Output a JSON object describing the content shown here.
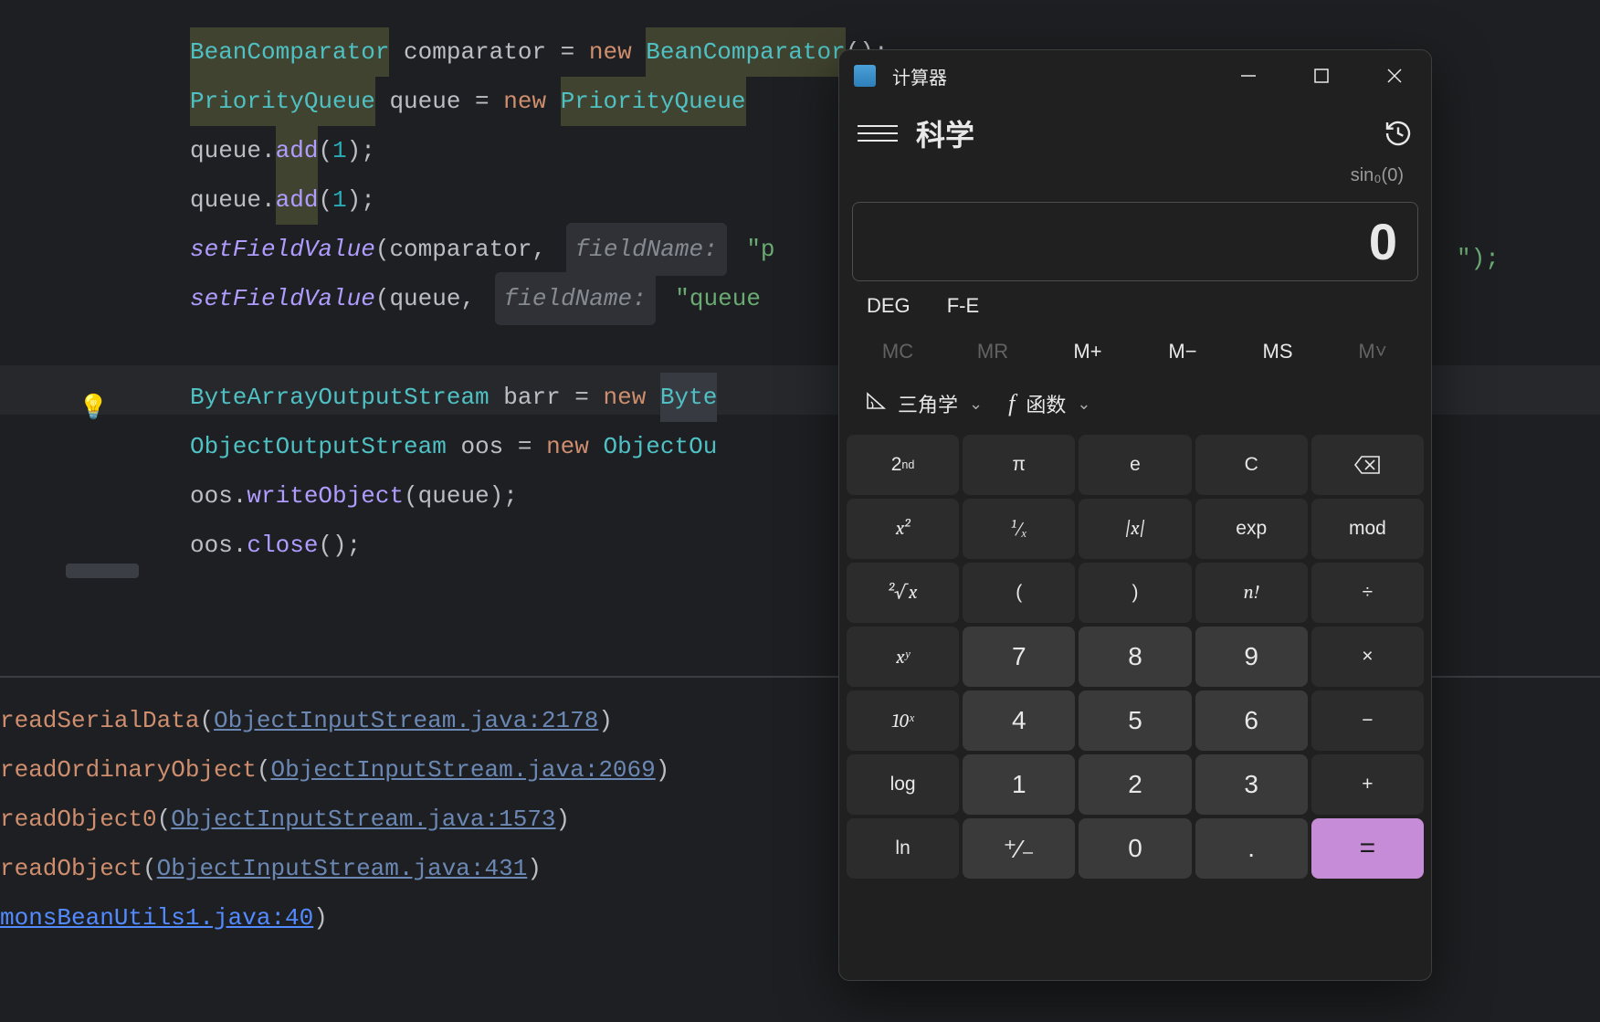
{
  "editor": {
    "lines": [
      {
        "segments": [
          {
            "t": "BeanComparator",
            "c": "tok-type sel"
          },
          {
            "t": " comparator = ",
            "c": "tok-plain"
          },
          {
            "t": "new ",
            "c": "tok-keyword"
          },
          {
            "t": "BeanComparator",
            "c": "tok-type sel"
          },
          {
            "t": "();",
            "c": "tok-plain"
          }
        ]
      },
      {
        "segments": [
          {
            "t": "PriorityQueue",
            "c": "tok-type sel"
          },
          {
            "t": " queue = ",
            "c": "tok-plain"
          },
          {
            "t": "new ",
            "c": "tok-keyword"
          },
          {
            "t": "PriorityQueue",
            "c": "tok-type sel"
          }
        ]
      },
      {
        "segments": [
          {
            "t": "queue.",
            "c": "tok-plain"
          },
          {
            "t": "add",
            "c": "tok-call sel"
          },
          {
            "t": "(",
            "c": "tok-plain"
          },
          {
            "t": "1",
            "c": "tok-num"
          },
          {
            "t": ");",
            "c": "tok-plain"
          }
        ]
      },
      {
        "segments": [
          {
            "t": "queue.",
            "c": "tok-plain"
          },
          {
            "t": "add",
            "c": "tok-call sel"
          },
          {
            "t": "(",
            "c": "tok-plain"
          },
          {
            "t": "1",
            "c": "tok-num"
          },
          {
            "t": ");",
            "c": "tok-plain"
          }
        ]
      },
      {
        "segments": [
          {
            "t": "setFieldValue",
            "c": "tok-method"
          },
          {
            "t": "(comparator, ",
            "c": "tok-plain"
          },
          {
            "t": "fieldName:",
            "c": "tok-hint"
          },
          {
            "t": " \"p",
            "c": "tok-str"
          }
        ]
      },
      {
        "segments": [
          {
            "t": "setFieldValue",
            "c": "tok-method"
          },
          {
            "t": "(queue, ",
            "c": "tok-plain"
          },
          {
            "t": "fieldName:",
            "c": "tok-hint"
          },
          {
            "t": " \"queue",
            "c": "tok-str"
          }
        ]
      },
      {
        "segments": []
      },
      {
        "segments": [
          {
            "t": "ByteArrayOutputStream",
            "c": "tok-type"
          },
          {
            "t": " barr = ",
            "c": "tok-plain"
          },
          {
            "t": "new ",
            "c": "tok-keyword"
          },
          {
            "t": "Byte",
            "c": "tok-type hl"
          }
        ]
      },
      {
        "segments": [
          {
            "t": "ObjectOutputStream",
            "c": "tok-type"
          },
          {
            "t": " oos = ",
            "c": "tok-plain"
          },
          {
            "t": "new ",
            "c": "tok-keyword"
          },
          {
            "t": "ObjectOu",
            "c": "tok-type"
          }
        ]
      },
      {
        "segments": [
          {
            "t": "oos.",
            "c": "tok-plain"
          },
          {
            "t": "writeObject",
            "c": "tok-call"
          },
          {
            "t": "(queue);",
            "c": "tok-plain"
          }
        ]
      },
      {
        "segments": [
          {
            "t": "oos.",
            "c": "tok-plain"
          },
          {
            "t": "close",
            "c": "tok-call"
          },
          {
            "t": "();",
            "c": "tok-plain"
          }
        ]
      }
    ]
  },
  "trace": [
    {
      "method": "readSerialData",
      "link": "ObjectInputStream.java:2178"
    },
    {
      "method": "readOrdinaryObject",
      "link": "ObjectInputStream.java:2069"
    },
    {
      "method": "readObject0",
      "link": "ObjectInputStream.java:1573"
    },
    {
      "method": "readObject",
      "link": "ObjectInputStream.java:431"
    },
    {
      "method": "",
      "link": "monsBeanUtils1.java:40",
      "blue": true
    }
  ],
  "calc": {
    "title": "计算器",
    "mode": "科学",
    "expression": "sin₀(0)",
    "result": "0",
    "options": [
      "DEG",
      "F-E"
    ],
    "memory": [
      {
        "label": "MC",
        "dim": true
      },
      {
        "label": "MR",
        "dim": true
      },
      {
        "label": "M+",
        "dim": false
      },
      {
        "label": "M−",
        "dim": false
      },
      {
        "label": "MS",
        "dim": false
      },
      {
        "label": "M˅",
        "dim": true
      }
    ],
    "dropdowns": {
      "trig": "三角学",
      "func": "函数"
    },
    "keys": [
      [
        {
          "l": "2nd",
          "k": "func",
          "sup": true
        },
        {
          "l": "π",
          "k": "func"
        },
        {
          "l": "e",
          "k": "func"
        },
        {
          "l": "C",
          "k": "func"
        },
        {
          "l": "⌫",
          "k": "func",
          "icon": "backspace"
        }
      ],
      [
        {
          "l": "x²",
          "k": "func",
          "ital": true
        },
        {
          "l": "¹⁄ₓ",
          "k": "func",
          "ital": true
        },
        {
          "l": "|x|",
          "k": "func",
          "ital": true
        },
        {
          "l": "exp",
          "k": "func"
        },
        {
          "l": "mod",
          "k": "func"
        }
      ],
      [
        {
          "l": "²√x",
          "k": "func",
          "ital": true
        },
        {
          "l": "(",
          "k": "func"
        },
        {
          "l": ")",
          "k": "func"
        },
        {
          "l": "n!",
          "k": "func",
          "ital": true
        },
        {
          "l": "÷",
          "k": "func"
        }
      ],
      [
        {
          "l": "xʸ",
          "k": "func",
          "ital": true
        },
        {
          "l": "7",
          "k": "num"
        },
        {
          "l": "8",
          "k": "num"
        },
        {
          "l": "9",
          "k": "num"
        },
        {
          "l": "×",
          "k": "func"
        }
      ],
      [
        {
          "l": "10ˣ",
          "k": "func",
          "ital": true
        },
        {
          "l": "4",
          "k": "num"
        },
        {
          "l": "5",
          "k": "num"
        },
        {
          "l": "6",
          "k": "num"
        },
        {
          "l": "−",
          "k": "func"
        }
      ],
      [
        {
          "l": "log",
          "k": "func"
        },
        {
          "l": "1",
          "k": "num"
        },
        {
          "l": "2",
          "k": "num"
        },
        {
          "l": "3",
          "k": "num"
        },
        {
          "l": "+",
          "k": "func"
        }
      ],
      [
        {
          "l": "ln",
          "k": "func"
        },
        {
          "l": "⁺⁄₋",
          "k": "num"
        },
        {
          "l": "0",
          "k": "num"
        },
        {
          "l": ".",
          "k": "num"
        },
        {
          "l": "=",
          "k": "eq"
        }
      ]
    ]
  },
  "trailing_text": "\");"
}
